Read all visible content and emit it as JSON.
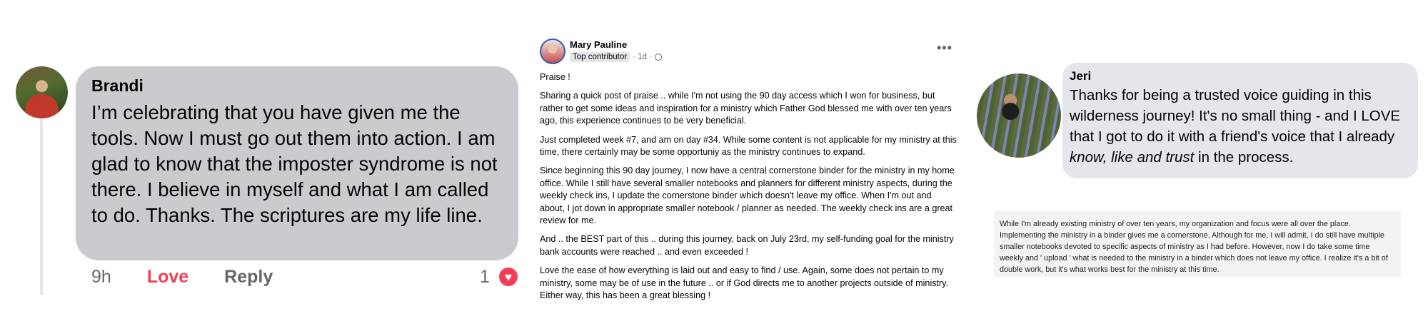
{
  "brandi_comment": {
    "name": "Brandi",
    "text": "I’m celebrating that you have given me the tools. Now I must go out them into action. I am glad to know that the imposter syndrome is not there. I believe in myself and what I am called to do. Thanks. The scriptures are my life line.",
    "time": "9h",
    "love_label": "Love",
    "reply_label": "Reply",
    "reaction_count": "1",
    "reaction_icon": "heart-icon",
    "accent_color": "#f33e58"
  },
  "mary_post": {
    "author": "Mary Pauline",
    "badge": "Top contributor",
    "time": "· 1d ·",
    "privacy_icon": "globe-icon",
    "more_label": "•••",
    "paragraphs": [
      "Praise !",
      "Sharing a quick post of praise .. while I'm not using the 90 day access which I won for business, but rather to get some ideas and inspiration for a ministry which Father God blessed me with over ten years ago, this experience continues to be very beneficial.",
      "Just completed week #7, and am on day #34.  While some content is not applicable for my ministry at this time, there certainly may be some opportuniy as the ministry continues to expand.",
      "Since beginning this 90 day journey, I now have a central cornerstone binder for the ministry in my home office.  While I still have several smaller notebooks and planners for different ministry aspects, during the weekly check ins, I update the cornerstone binder which doesn't leave my office.  When I'm out and about, I jot down in appropriate smaller notebook / planner as needed.  The weekly check ins are a great review for me.",
      "And .. the BEST part of this .. during this journey, back on July 23rd, my self-funding goal for the ministry bank accounts were reached .. and even exceeded !",
      "Love the ease of how everything is laid out and easy to find / use.  Again, some does not pertain to my ministry, some may be of use in the future .. or if God directs me to another projects outside of ministry.  Either way, this has been a great blessing !"
    ]
  },
  "jeri_comment": {
    "name": "Jeri",
    "text_before": "Thanks for being a trusted voice guiding in this wilderness journey! It's no small thing - and I LOVE that I got to do it with a friend's voice that I already ",
    "text_italic": "know, like and trust",
    "text_after": " in the process."
  },
  "ministry_note": {
    "text": "While I'm already existing ministry of over ten years, my organization and focus were all over the place. Implementing the ministry in a binder gives me a cornerstone. Although for me, I will admit, I do still have multiple smaller notebooks devoted to specific aspects of ministry as I had before. However, now I do take some time weekly and ' upload ' what is needed to the ministry in a binder which does not leave my office. I realize it's a bit of double work, but it's what works best for the ministry at this time."
  }
}
